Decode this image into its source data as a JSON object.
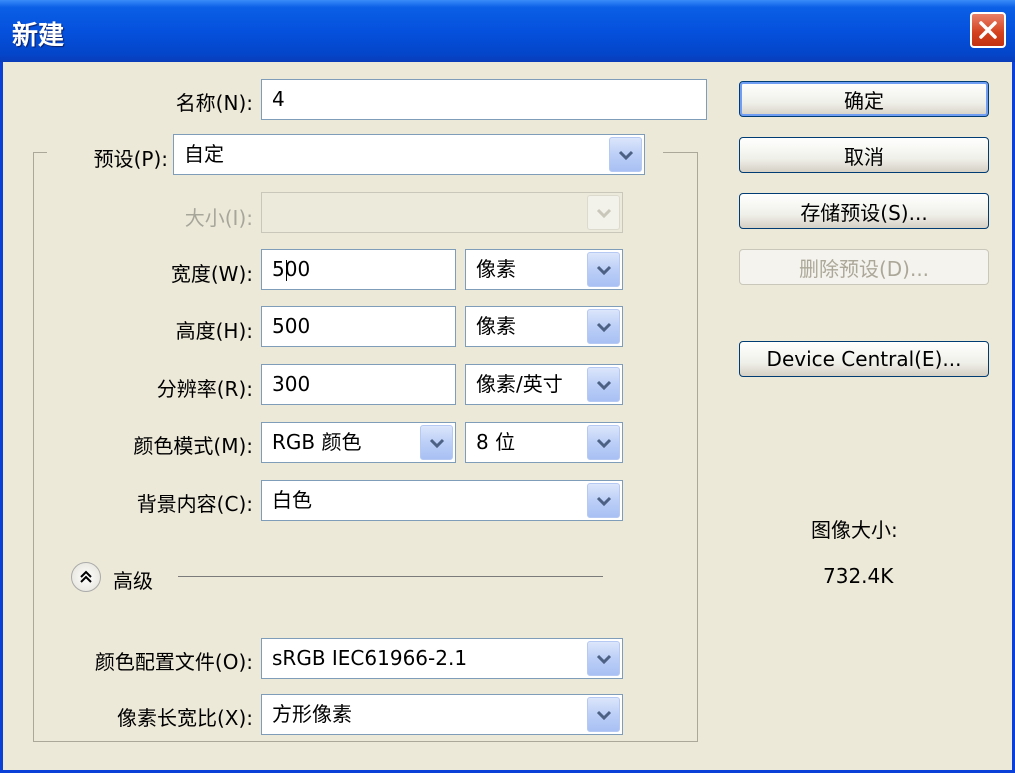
{
  "window": {
    "title": "新建"
  },
  "form": {
    "name": {
      "label": "名称(N):",
      "value": "4"
    },
    "preset": {
      "label": "预设(P):",
      "value": "自定"
    },
    "size": {
      "label": "大小(I):",
      "value": ""
    },
    "width": {
      "label": "宽度(W):",
      "value": "500",
      "unit": "像素"
    },
    "height": {
      "label": "高度(H):",
      "value": "500",
      "unit": "像素"
    },
    "resolution": {
      "label": "分辨率(R):",
      "value": "300",
      "unit": "像素/英寸"
    },
    "color_mode": {
      "label": "颜色模式(M):",
      "value": "RGB 颜色",
      "depth": "8 位"
    },
    "background": {
      "label": "背景内容(C):",
      "value": "白色"
    },
    "advanced": {
      "label": "高级"
    },
    "color_profile": {
      "label": "颜色配置文件(O):",
      "value": "sRGB IEC61966-2.1"
    },
    "pixel_aspect": {
      "label": "像素长宽比(X):",
      "value": "方形像素"
    }
  },
  "buttons": {
    "ok": "确定",
    "cancel": "取消",
    "save_preset": "存储预设(S)...",
    "delete_preset": "删除预设(D)...",
    "device_central": "Device Central(E)..."
  },
  "info": {
    "image_size_label": "图像大小:",
    "image_size_value": "732.4K"
  },
  "colors": {
    "titlebar": "#0551dd",
    "window_bg": "#ece9d8",
    "close": "#d2401c"
  }
}
